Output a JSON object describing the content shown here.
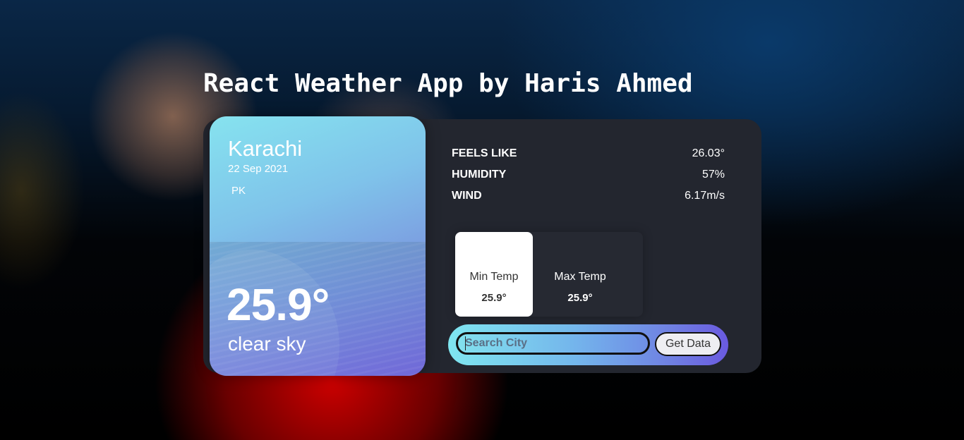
{
  "app": {
    "title": "React Weather App by Haris Ahmed"
  },
  "current": {
    "city": "Karachi",
    "date": "22 Sep 2021",
    "country": "PK",
    "temperature": "25.9°",
    "condition": "clear sky"
  },
  "stats": [
    {
      "label": "FEELS LIKE",
      "value": "26.03°"
    },
    {
      "label": "HUMIDITY",
      "value": "57%"
    },
    {
      "label": "WIND",
      "value": "6.17m/s"
    }
  ],
  "minmax": {
    "min_label": "Min Temp",
    "min_value": "25.9°",
    "max_label": "Max Temp",
    "max_value": "25.9°",
    "active": "min"
  },
  "search": {
    "placeholder": "Search City",
    "value": "",
    "button_label": "Get Data"
  },
  "colors": {
    "panel_bg": "#23262f",
    "card_gradient_start": "#86e3ef",
    "card_gradient_end": "#7168d7",
    "search_gradient_start": "#7fe6f0",
    "search_gradient_end": "#6a5ae0",
    "text_primary": "#ffffff"
  }
}
